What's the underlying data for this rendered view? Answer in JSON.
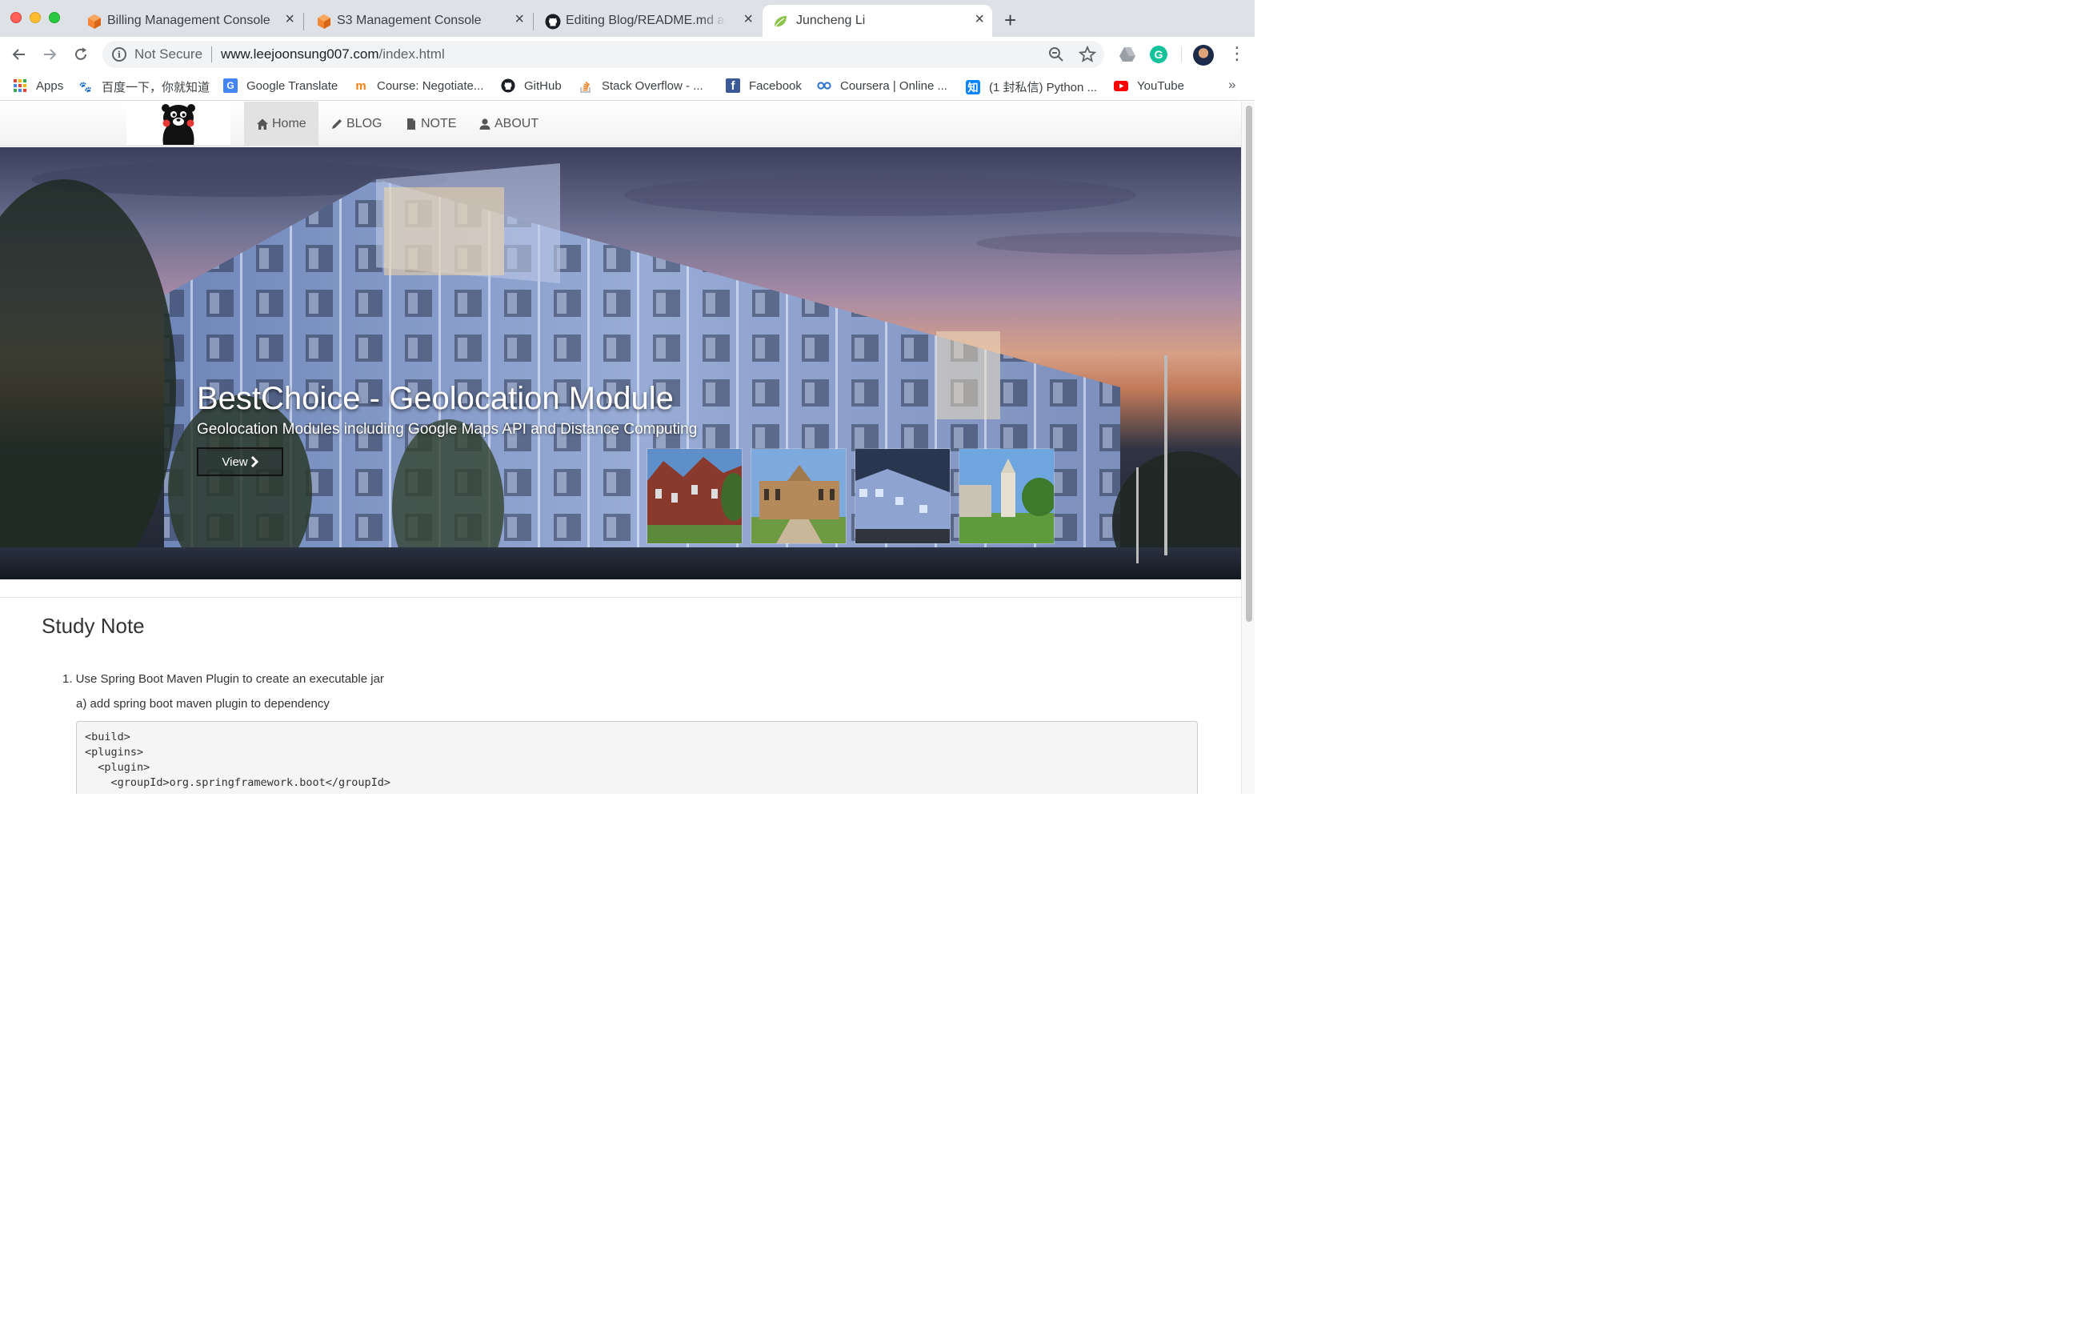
{
  "browser": {
    "tabs": [
      {
        "title": "Billing Management Console",
        "favicon": "aws-cube-icon"
      },
      {
        "title": "S3 Management Console",
        "favicon": "aws-cube-icon"
      },
      {
        "title": "Editing Blog/README.md at ma",
        "favicon": "github-icon"
      },
      {
        "title": "Juncheng Li",
        "favicon": "leaf-icon"
      }
    ],
    "active_tab_index": 3,
    "security_label": "Not Secure",
    "url_host": "www.leejoonsung007.com",
    "url_path": "/index.html",
    "bookmarks": [
      {
        "label": "Apps",
        "icon": "apps-grid-icon"
      },
      {
        "label": "百度一下，你就知道",
        "icon": "baidu-paw-icon"
      },
      {
        "label": "Google Translate",
        "icon": "google-translate-icon"
      },
      {
        "label": "Course: Negotiate...",
        "icon": "moodle-icon"
      },
      {
        "label": "GitHub",
        "icon": "github-icon"
      },
      {
        "label": "Stack Overflow - ...",
        "icon": "stackoverflow-icon"
      },
      {
        "label": "Facebook",
        "icon": "facebook-icon"
      },
      {
        "label": "Coursera | Online ...",
        "icon": "coursera-icon"
      },
      {
        "label": "(1 封私信) Python ...",
        "icon": "zhihu-icon"
      },
      {
        "label": "YouTube",
        "icon": "youtube-icon"
      }
    ],
    "bookmarks_more": "»"
  },
  "site": {
    "nav": [
      {
        "label": "Home",
        "icon": "home-icon",
        "active": true
      },
      {
        "label": "BLOG",
        "icon": "pencil-icon",
        "active": false
      },
      {
        "label": "NOTE",
        "icon": "file-icon",
        "active": false
      },
      {
        "label": "ABOUT",
        "icon": "user-icon",
        "active": false
      }
    ],
    "hero": {
      "title": "BestChoice - Geolocation Module",
      "subtitle": "Geolocation Modules including Google Maps API and Distance Computing",
      "button_label": "View"
    },
    "section_title": "Study Note",
    "note": {
      "item_1": "1. Use Spring Boot Maven Plugin to create an executable jar",
      "item_1a": "a) add spring boot maven plugin to dependency",
      "code_lines": [
        "<build>",
        "<plugins>",
        "  <plugin>",
        "    <groupId>org.springframework.boot</groupId>"
      ]
    }
  }
}
